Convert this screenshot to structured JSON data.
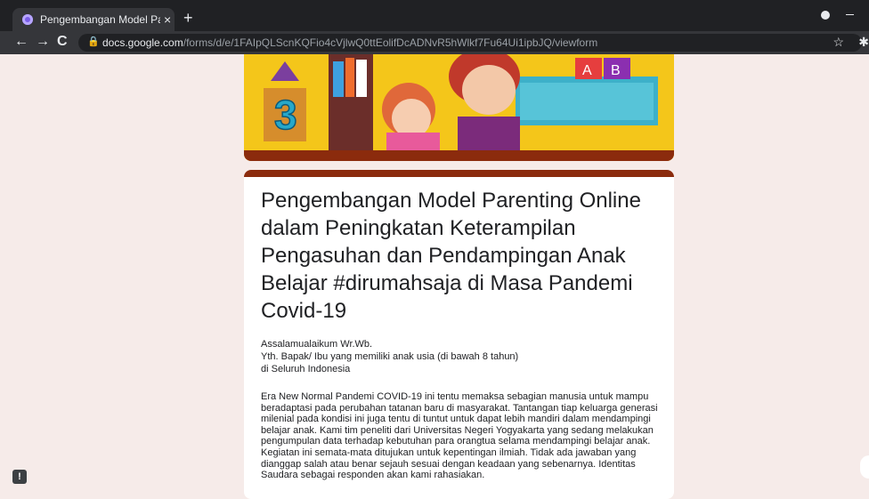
{
  "browser": {
    "tab_title": "Pengembangan Model Parenting",
    "tab_close": "×",
    "new_tab": "+",
    "url_host": "docs.google.com",
    "url_path": "/forms/d/e/1FAIpQLScnKQFio4cVjlwQ0ttEolifDcADNvR5hWlkf7Fu64Ui1ipbJQ/viewform",
    "back_icon": "←",
    "forward_icon": "→",
    "reload_icon": "C",
    "lock_icon": "🔒",
    "star_icon": "☆",
    "ext_icon": "✱"
  },
  "header_image": {
    "blocks": [
      "A",
      "B"
    ],
    "number": "3"
  },
  "form": {
    "title": "Pengembangan Model Parenting Online dalam Peningkatan Keterampilan Pengasuhan dan Pendampingan Anak Belajar #dirumahsaja di Masa Pandemi Covid-19",
    "greeting": [
      "Assalamualaikum Wr.Wb.",
      "Yth. Bapak/ Ibu yang memiliki anak usia (di bawah 8 tahun)",
      "di Seluruh Indonesia"
    ],
    "description": "Era New Normal Pandemi COVID-19 ini tentu memaksa sebagian manusia untuk mampu beradaptasi pada perubahan tatanan baru di masyarakat. Tantangan tiap keluarga generasi milenial pada kondisi ini juga tentu di tuntut untuk dapat lebih mandiri dalam mendampingi belajar anak. Kami tim peneliti dari Universitas Negeri Yogyakarta yang sedang melakukan pengumpulan data terhadap kebutuhan para orangtua selama mendampingi belajar anak. Kegiatan  ini semata-mata ditujukan untuk kepentingan ilmiah. Tidak ada jawaban yang dianggap salah atau benar sejauh sesuai dengan keadaan yang sebenarnya. Identitas Saudara sebagai responden akan kami rahasiakan.",
    "accent_color": "#8b2b0d"
  },
  "report_icon": "!"
}
